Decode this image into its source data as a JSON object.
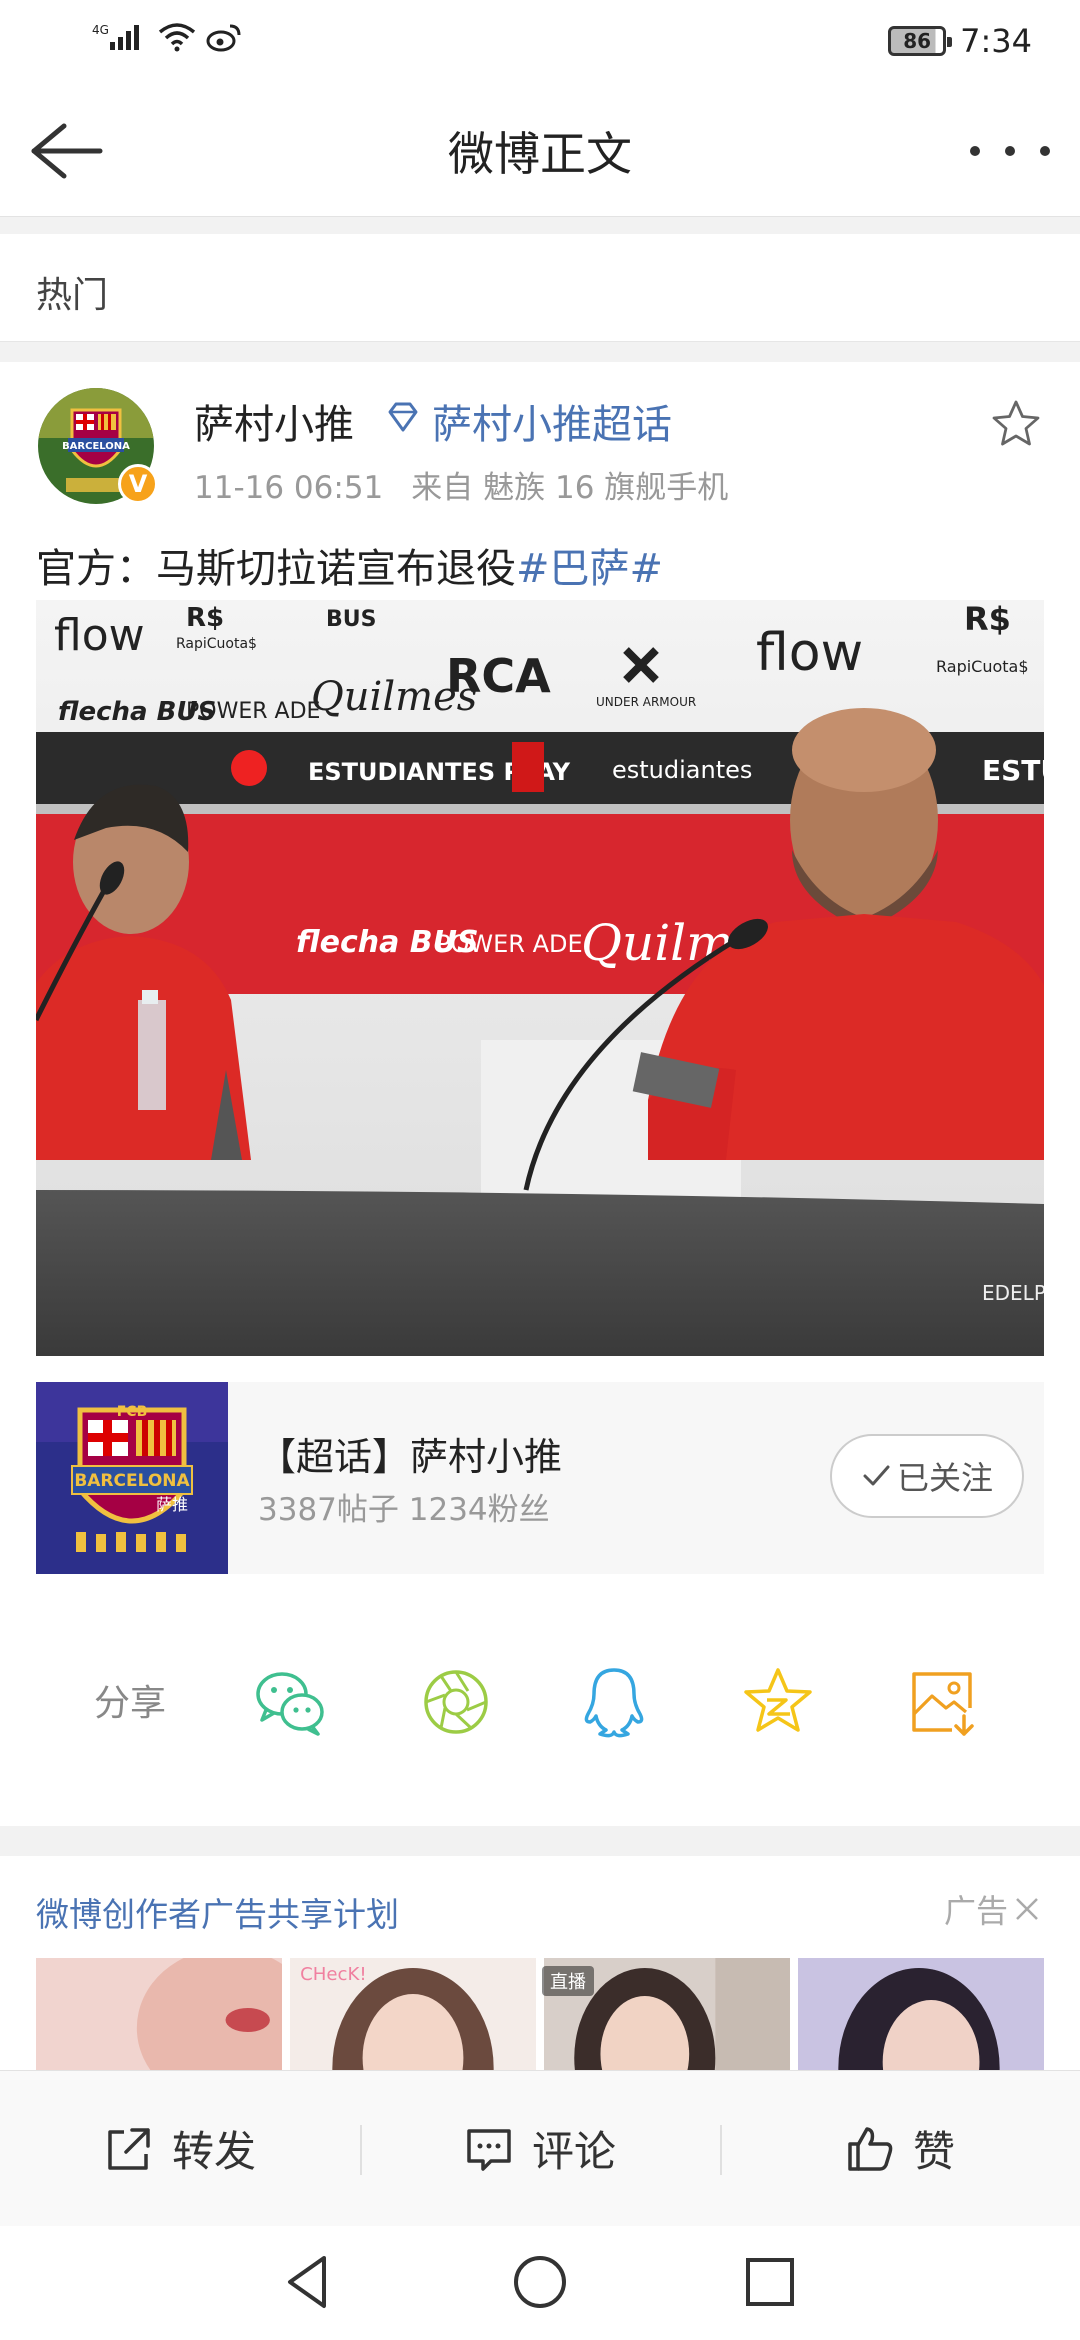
{
  "status_bar": {
    "network": "4G",
    "battery": "86",
    "time": "7:34"
  },
  "nav": {
    "title": "微博正文"
  },
  "section": {
    "label": "热门"
  },
  "post": {
    "author": "萨村小推",
    "topic_link": "萨村小推超话",
    "time": "11-16 06:51",
    "source": "来自 魅族 16 旗舰手机",
    "text": "官方：马斯切拉诺宣布退役",
    "hashtag": "#巴萨#",
    "verified_badge": "V"
  },
  "photo_signage": {
    "row1": [
      "flow",
      "R$",
      "RapiCuota$",
      "BUS",
      "Quilmes",
      "RCA",
      "UNDER ARMOUR",
      "flow",
      "R$",
      "RapiCuota$"
    ],
    "row2": [
      "ESTUDIANTES PLAY",
      "estudiantes",
      "ESTU"
    ],
    "row3": [
      "flecha BUS",
      "POWER ADE",
      "Quilmes"
    ],
    "table": "EDELP"
  },
  "topic_card": {
    "title": "【超话】萨村小推",
    "stats": "3387帖子 1234粉丝",
    "follow_label": "已关注",
    "logo_text": {
      "top": "FCB",
      "name": "BARCELONA",
      "sub": "萨推"
    }
  },
  "share": {
    "label": "分享",
    "targets": [
      "wechat-icon",
      "moments-icon",
      "qq-icon",
      "qzone-icon",
      "save-image-icon"
    ]
  },
  "ad": {
    "title": "微博创作者广告共享计划",
    "tag": "广告",
    "badge_check": "CHecK!",
    "badge_live": "直播"
  },
  "actions": {
    "repost": "转发",
    "comment": "评论",
    "like": "赞"
  },
  "colors": {
    "link": "#4a73b3",
    "badge": "#f7a21a",
    "wechat": "#3fbf8f",
    "moments": "#9ccc45",
    "qq": "#35a6e0",
    "qzone": "#f5c518",
    "save": "#f0a020"
  }
}
